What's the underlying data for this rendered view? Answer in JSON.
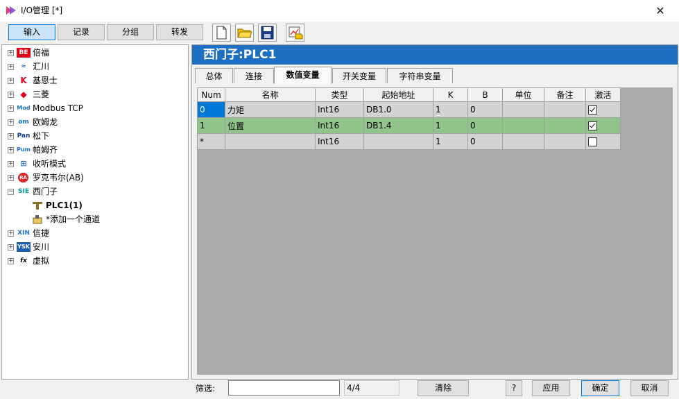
{
  "window": {
    "title": "I/O管理 [*]",
    "close_label": "✕"
  },
  "toolbar": {
    "tabs": [
      {
        "label": "输入",
        "active": true
      },
      {
        "label": "记录",
        "active": false
      },
      {
        "label": "分组",
        "active": false
      },
      {
        "label": "转发",
        "active": false
      }
    ],
    "icons": [
      "new-file-icon",
      "open-folder-icon",
      "save-icon",
      "chart-icon"
    ]
  },
  "tree": {
    "items": [
      {
        "brand": "BE",
        "label": "倍福",
        "expander": "+"
      },
      {
        "brand": "≈",
        "label": "汇川",
        "expander": "+"
      },
      {
        "brand": "K",
        "label": "基恩士",
        "expander": "+"
      },
      {
        "brand": "◆",
        "label": "三菱",
        "expander": "+"
      },
      {
        "brand": "Mod",
        "label": "Modbus TCP",
        "expander": "+"
      },
      {
        "brand": "om",
        "label": "欧姆龙",
        "expander": "+"
      },
      {
        "brand": "Pan",
        "label": "松下",
        "expander": "+"
      },
      {
        "brand": "Pum",
        "label": "帕姆齐",
        "expander": "+"
      },
      {
        "brand": "⊞",
        "label": "收听模式",
        "expander": "+"
      },
      {
        "brand": "RA",
        "label": "罗克韦尔(AB)",
        "expander": "+"
      },
      {
        "brand": "SIE",
        "label": "西门子",
        "expander": "−"
      },
      {
        "brand": "",
        "label": "PLC1(1)",
        "child": true
      },
      {
        "brand": "",
        "label": "*添加一个通道",
        "child": true
      },
      {
        "brand": "XIN",
        "label": "信捷",
        "expander": "+"
      },
      {
        "brand": "YSK",
        "label": "安川",
        "expander": "+"
      },
      {
        "brand": "fx",
        "label": "虚拟",
        "expander": "+"
      }
    ]
  },
  "device": {
    "title": "西门子:PLC1"
  },
  "tabs": [
    {
      "label": "总体",
      "active": false
    },
    {
      "label": "连接",
      "active": false
    },
    {
      "label": "数值变量",
      "active": true
    },
    {
      "label": "开关变量",
      "active": false
    },
    {
      "label": "字符串变量",
      "active": false
    }
  ],
  "grid": {
    "columns": [
      "Num",
      "名称",
      "类型",
      "起始地址",
      "K",
      "B",
      "单位",
      "备注",
      "激活"
    ],
    "rows": [
      {
        "num": "0",
        "name": "力矩",
        "type": "Int16",
        "addr": "DB1.0",
        "k": "1",
        "b": "0",
        "unit": "",
        "note": "",
        "active": true
      },
      {
        "num": "1",
        "name": "位置",
        "type": "Int16",
        "addr": "DB1.4",
        "k": "1",
        "b": "0",
        "unit": "",
        "note": "",
        "active": true
      },
      {
        "num": "*",
        "name": "",
        "type": "Int16",
        "addr": "",
        "k": "1",
        "b": "0",
        "unit": "",
        "note": "",
        "active": false
      }
    ]
  },
  "footer": {
    "filter_label": "筛选:",
    "filter_value": "",
    "count": "4/4",
    "clear_label": "清除",
    "help_label": "?",
    "apply_label": "应用",
    "ok_label": "确定",
    "cancel_label": "取消"
  },
  "colors": {
    "header_blue": "#1e6fc2",
    "selected_row": "#91c48a",
    "selected_cell": "#0078d7",
    "grid_background": "#aaaaaa"
  }
}
